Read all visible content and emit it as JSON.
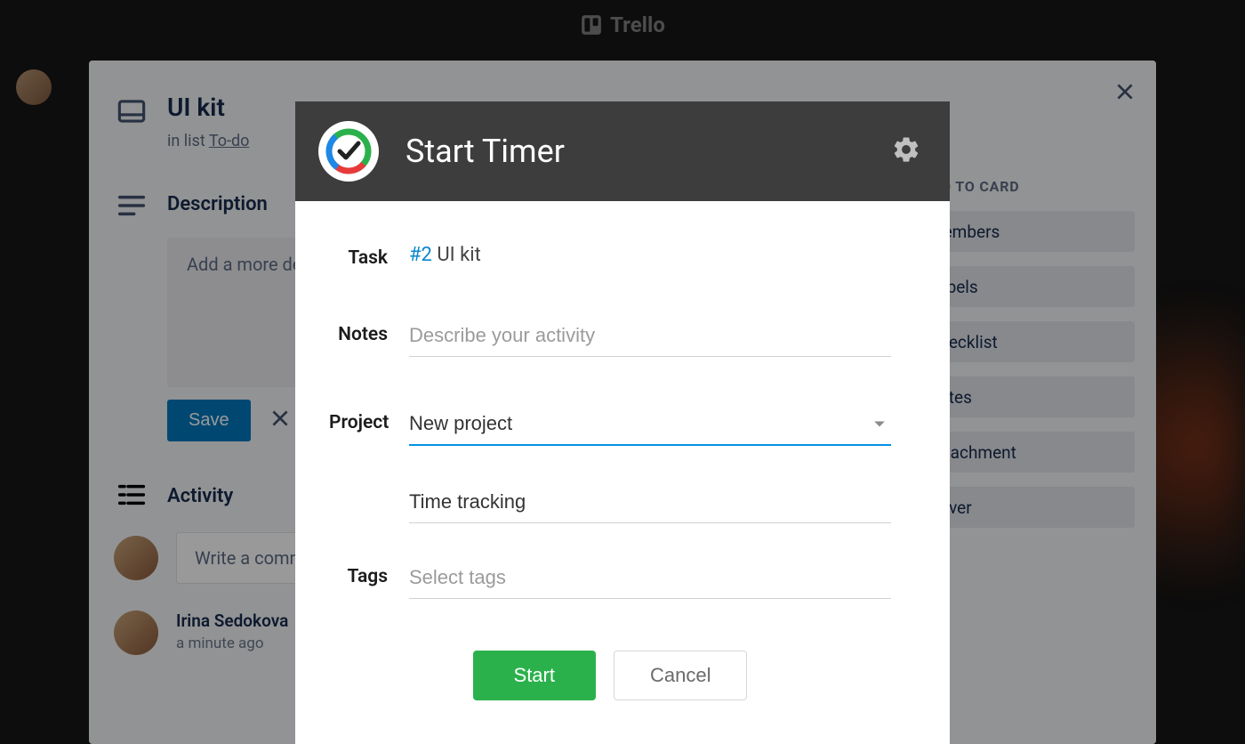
{
  "topbar": {
    "brand": "Trello"
  },
  "card": {
    "title": "UI kit",
    "list_prefix": "in list ",
    "list_name": "To-do",
    "description_heading": "Description",
    "description_placeholder": "Add a more detailed description…",
    "save_label": "Save",
    "activity_heading": "Activity",
    "comment_placeholder": "Write a comment…",
    "activity_user": "Irina Sedokova",
    "activity_time": "a minute ago"
  },
  "sidebar": {
    "heading": "ADD TO CARD",
    "items": [
      {
        "label": "Members"
      },
      {
        "label": "Labels"
      },
      {
        "label": "Checklist"
      },
      {
        "label": "Dates"
      },
      {
        "label": "Attachment"
      },
      {
        "label": "Cover"
      }
    ]
  },
  "timer": {
    "title": "Start Timer",
    "fields": {
      "task_label": "Task",
      "task_number": "#2",
      "task_name": "UI kit",
      "notes_label": "Notes",
      "notes_placeholder": "Describe your activity",
      "project_label": "Project",
      "project_value": "New project",
      "project_sub": "Time tracking",
      "tags_label": "Tags",
      "tags_placeholder": "Select tags"
    },
    "start_label": "Start",
    "cancel_label": "Cancel"
  }
}
